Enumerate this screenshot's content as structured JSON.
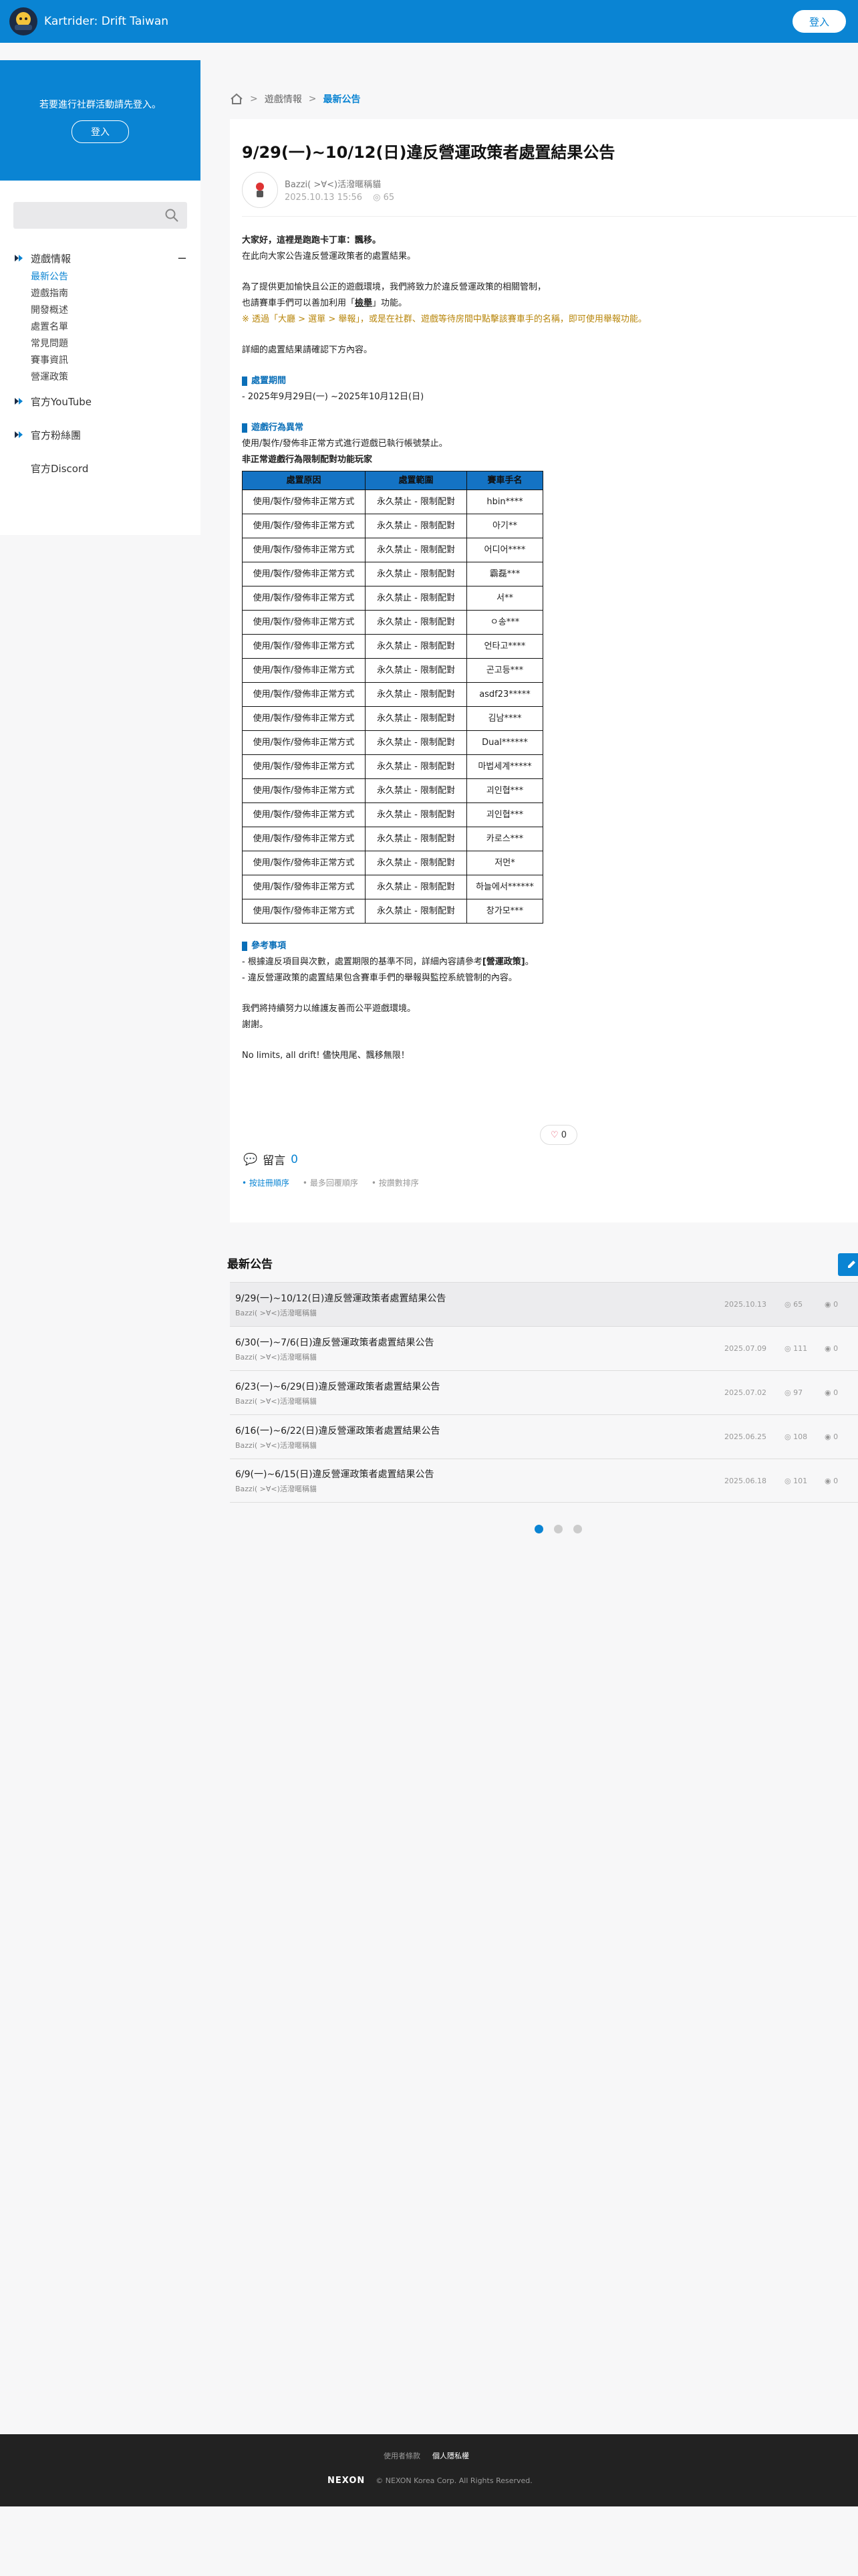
{
  "header": {
    "site_title": "Kartrider: Drift Taiwan",
    "login_label": "登入"
  },
  "sidebar": {
    "login_prompt": "若要進行社群活動請先登入。",
    "login_label": "登入",
    "group_title": "遊戲情報",
    "items": [
      "最新公告",
      "遊戲指南",
      "開發概述",
      "處置名單",
      "常見問題",
      "賽事資訊",
      "營運政策"
    ],
    "youtube": "官方YouTube",
    "fanpage": "官方粉絲團",
    "discord": "官方Discord"
  },
  "breadcrumb": {
    "level1": "遊戲情報",
    "level2": "最新公告"
  },
  "article": {
    "title": "9/29(一)~10/12(日)違反營運政策者處置結果公告",
    "author": "Bazzi( >∀<)活潑暱稱貓",
    "date": "2025.10.13 15:56",
    "views": "65",
    "greeting": "大家好，這裡是跑跑卡丁車：飄移。",
    "intro": "在此向大家公告違反營運政策者的處置結果。",
    "p1": "為了提供更加愉快且公正的遊戲環境，我們將致力於違反營運政策的相關管制，",
    "p2a": "也請賽車手們可以善加利用「",
    "p2b": "檢舉",
    "p2c": "」功能。",
    "p3": "※ 透過「大廳 > 選單 > 舉報」，或是在社群、遊戲等待房間中點擊該賽車手的名稱，即可使用舉報功能。",
    "p4": "詳細的處置結果請確認下方內容。",
    "sec1": "處置期間",
    "period": "- 2025年9月29日(一) ~2025年10月12日(日)",
    "sec2": "遊戲行為異常",
    "sec2_desc": "使用/製作/發佈非正常方式進行遊戲已執行帳號禁止。",
    "sec2_sub": "非正常遊戲行為限制配對功能玩家",
    "table_head": [
      "處置原因",
      "處置範圍",
      "賽車手名"
    ],
    "rows": [
      [
        "使用/製作/發佈非正常方式",
        "永久禁止 - 限制配對",
        "hbin****"
      ],
      [
        "使用/製作/發佈非正常方式",
        "永久禁止 - 限制配對",
        "아기**"
      ],
      [
        "使用/製作/發佈非正常方式",
        "永久禁止 - 限制配對",
        "어디어****"
      ],
      [
        "使用/製作/發佈非正常方式",
        "永久禁止 - 限制配對",
        "霸磊***"
      ],
      [
        "使用/製作/發佈非正常方式",
        "永久禁止 - 限制配對",
        "서**"
      ],
      [
        "使用/製作/發佈非正常方式",
        "永久禁止 - 限制配對",
        "ㅇ송***"
      ],
      [
        "使用/製作/發佈非正常方式",
        "永久禁止 - 限制配對",
        "언타고****"
      ],
      [
        "使用/製作/發佈非正常方式",
        "永久禁止 - 限制配對",
        "곤고등***"
      ],
      [
        "使用/製作/發佈非正常方式",
        "永久禁止 - 限制配對",
        "asdf23*****"
      ],
      [
        "使用/製作/發佈非正常方式",
        "永久禁止 - 限制配對",
        "김남****"
      ],
      [
        "使用/製作/發佈非正常方式",
        "永久禁止 - 限制配對",
        "Dual******"
      ],
      [
        "使用/製作/發佈非正常方式",
        "永久禁止 - 限制配對",
        "마법세계*****"
      ],
      [
        "使用/製作/發佈非正常方式",
        "永久禁止 - 限制配對",
        "괴인협***"
      ],
      [
        "使用/製作/發佈非正常方式",
        "永久禁止 - 限制配對",
        "괴인협***"
      ],
      [
        "使用/製作/發佈非正常方式",
        "永久禁止 - 限制配對",
        "카로스***"
      ],
      [
        "使用/製作/發佈非正常方式",
        "永久禁止 - 限制配對",
        "저먼*"
      ],
      [
        "使用/製作/發佈非正常方式",
        "永久禁止 - 限制配對",
        "하늘에서******"
      ],
      [
        "使用/製作/發佈非正常方式",
        "永久禁止 - 限制配對",
        "창가모***"
      ]
    ],
    "sec3": "參考事項",
    "ref1a": "- 根據違反項目與次數，處置期限的基準不同，詳細內容請參考",
    "ref1b": "[營運政策]",
    "ref1c": "。",
    "ref2": "- 違反營運政策的處置結果包含賽車手們的舉報與監控系統管制的內容。",
    "outro1": "我們將持續努力以維護友善而公平遊戲環境。",
    "outro2": "謝謝。",
    "outro3": "No limits, all drift! 儘快甩尾、飄移無限！",
    "likes": "0",
    "comments_label": "留言",
    "comments_count": "0",
    "sorts": [
      "按註冊順序",
      "最多回覆順序",
      "按讚數排序"
    ]
  },
  "latest": {
    "title": "最新公告",
    "items": [
      {
        "title": "9/29(一)~10/12(日)違反營運政策者處置結果公告",
        "author": "Bazzi( >∀<)活潑暱稱貓",
        "date": "2025.10.13",
        "views": "65",
        "comments": "0"
      },
      {
        "title": "6/30(一)~7/6(日)違反營運政策者處置結果公告",
        "author": "Bazzi( >∀<)活潑暱稱貓",
        "date": "2025.07.09",
        "views": "111",
        "comments": "0"
      },
      {
        "title": "6/23(一)~6/29(日)違反營運政策者處置結果公告",
        "author": "Bazzi( >∀<)活潑暱稱貓",
        "date": "2025.07.02",
        "views": "97",
        "comments": "0"
      },
      {
        "title": "6/16(一)~6/22(日)違反營運政策者處置結果公告",
        "author": "Bazzi( >∀<)活潑暱稱貓",
        "date": "2025.06.25",
        "views": "108",
        "comments": "0"
      },
      {
        "title": "6/9(一)~6/15(日)違反營運政策者處置結果公告",
        "author": "Bazzi( >∀<)活潑暱稱貓",
        "date": "2025.06.18",
        "views": "101",
        "comments": "0"
      }
    ]
  },
  "footer": {
    "terms": "使用者條款",
    "privacy": "個人隱私權",
    "brand": "NEXON",
    "copyright": "© NEXON Korea Corp. All Rights Reserved."
  }
}
